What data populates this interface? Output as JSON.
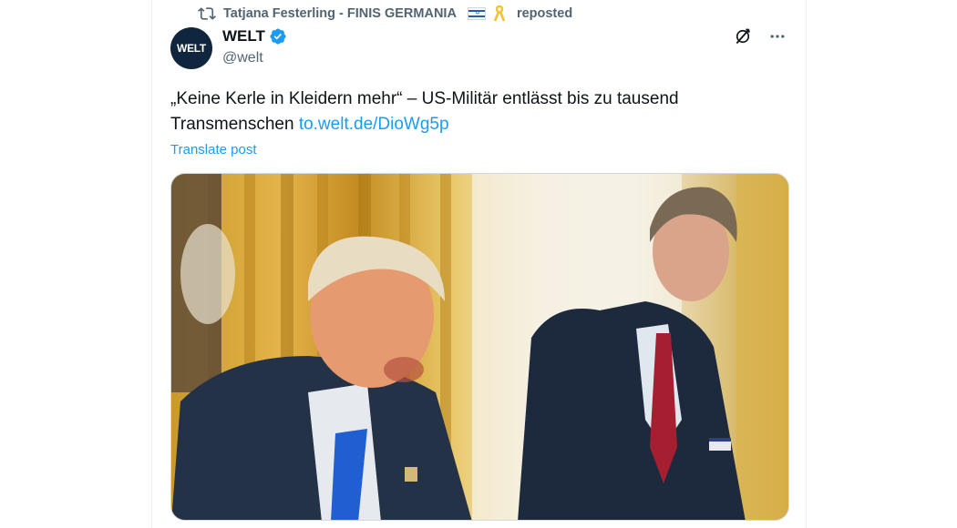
{
  "repost": {
    "reposter_name": "Tatjana Festerling - FINIS GERMANIA",
    "label": "reposted"
  },
  "author": {
    "avatar_text": "WELT",
    "name": "WELT",
    "handle": "@welt",
    "verified": true
  },
  "post": {
    "text": "„Keine Kerle in Kleidern mehr“ – US-Militär entlässt bis zu tausend Transmenschen ",
    "link": "to.welt.de/DioWg5p",
    "translate_label": "Translate post"
  },
  "icons": {
    "repost": "repost-icon",
    "verified": "verified-badge-icon",
    "grok": "grok-icon",
    "more": "more-options-icon",
    "flag": "israel-flag-icon",
    "ribbon": "yellow-ribbon-icon"
  },
  "colors": {
    "link": "#1d9bf0",
    "secondary_text": "#536471",
    "avatar_bg": "#10263e"
  }
}
